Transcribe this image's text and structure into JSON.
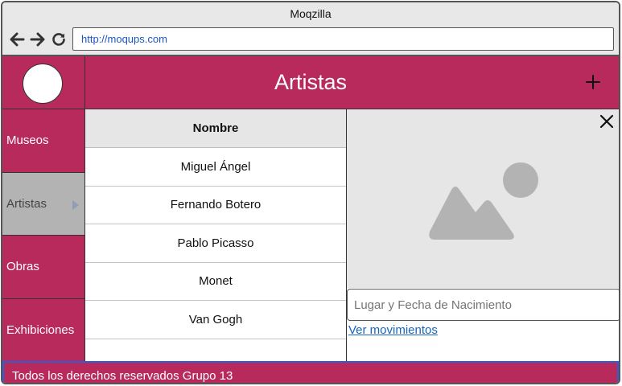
{
  "window": {
    "title": "Moqzilla"
  },
  "browser": {
    "url": "http://moqups.com",
    "icons": [
      "back-arrow-icon",
      "forward-arrow-icon",
      "reload-icon"
    ]
  },
  "header": {
    "title": "Artistas",
    "add_icon": "plus-icon"
  },
  "sidebar": {
    "items": [
      {
        "label": "Museos",
        "active": false
      },
      {
        "label": "Artistas",
        "active": true
      },
      {
        "label": "Obras",
        "active": false
      },
      {
        "label": "Exhibiciones",
        "active": false
      }
    ]
  },
  "table": {
    "header": "Nombre",
    "rows": [
      "Miguel Ángel",
      "Fernando Botero",
      "Pablo Picasso",
      "Monet",
      "Van Gogh",
      ""
    ]
  },
  "detail": {
    "close_icon": "close-icon",
    "image_icon": "image-placeholder-icon",
    "birth_placeholder": "Lugar y Fecha de Nacimiento",
    "movements_link": "Ver movimientos"
  },
  "footer": {
    "text": "Todos los derechos reservados Grupo 13"
  },
  "colors": {
    "brand": "#b82a5c",
    "active_item": "#b3b3b3",
    "link": "#1565c0",
    "footer_border": "#2b5fd6"
  }
}
